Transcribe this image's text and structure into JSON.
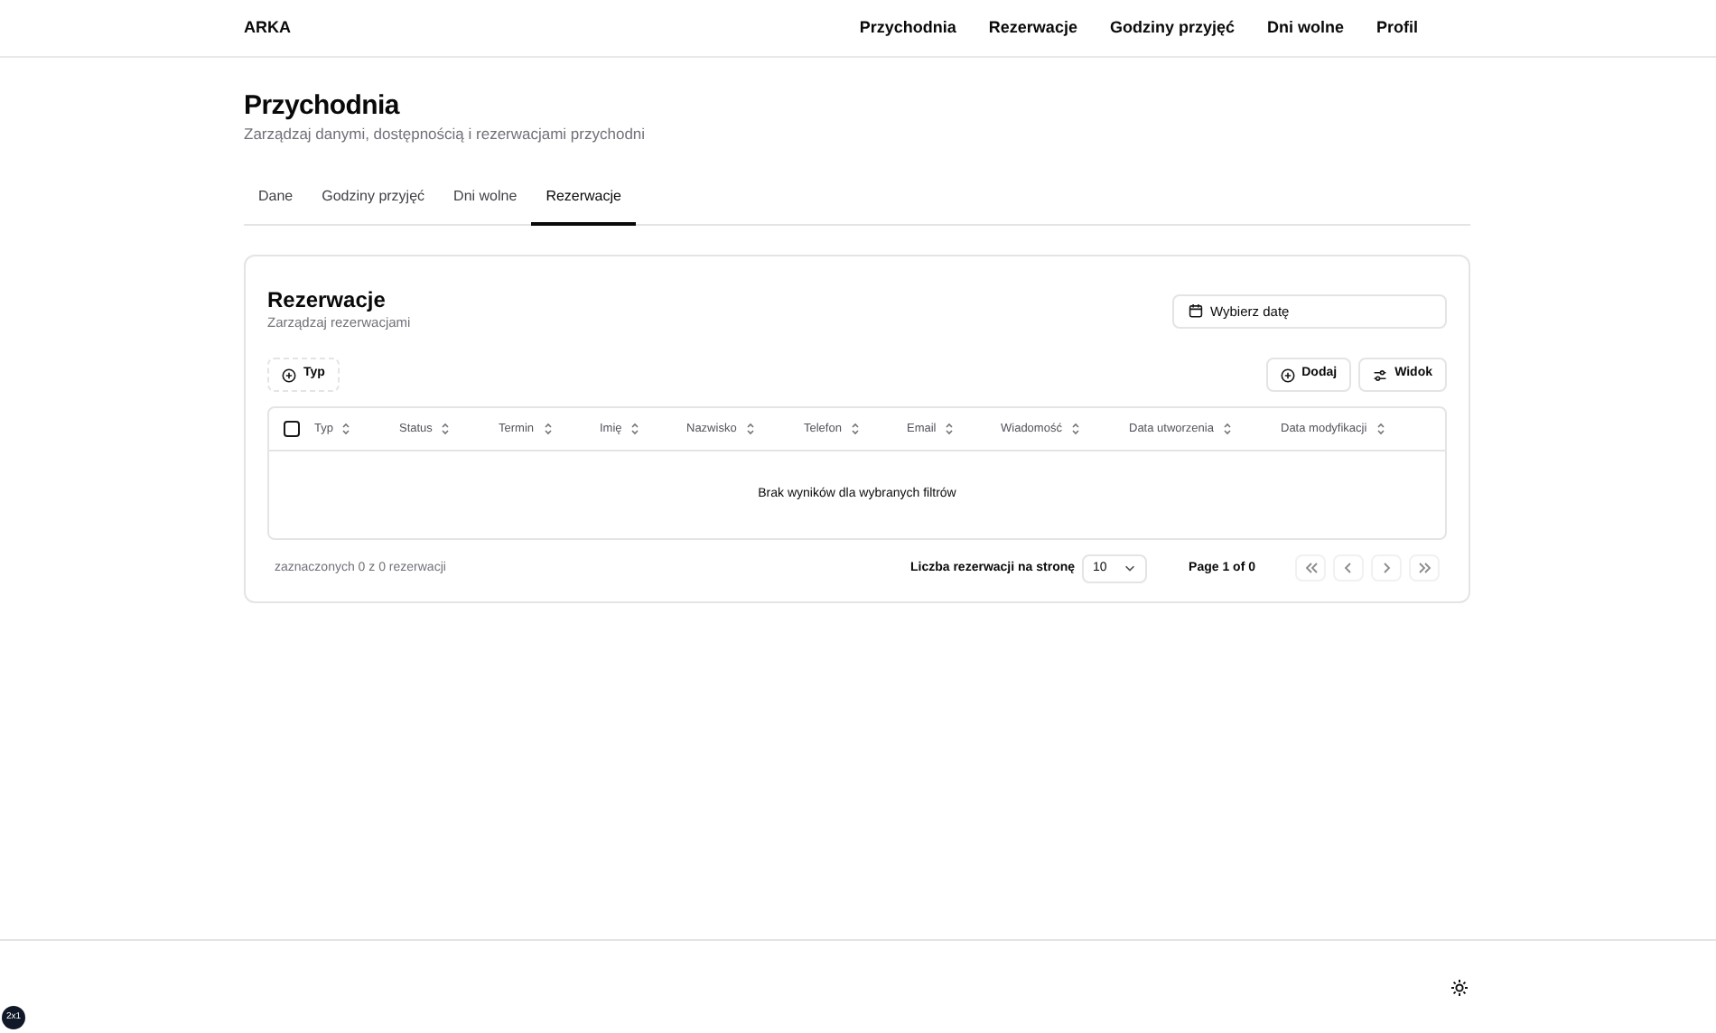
{
  "brand": "ARKA",
  "nav": [
    "Przychodnia",
    "Rezerwacje",
    "Godziny przyjęć",
    "Dni wolne",
    "Profil"
  ],
  "page": {
    "title": "Przychodnia",
    "subtitle": "Zarządzaj danymi, dostępnością i rezerwacjami przychodni"
  },
  "tabs": [
    {
      "label": "Dane",
      "selected": false
    },
    {
      "label": "Godziny przyjęć",
      "selected": false
    },
    {
      "label": "Dni wolne",
      "selected": false
    },
    {
      "label": "Rezerwacje",
      "selected": true
    }
  ],
  "card": {
    "title": "Rezerwacje",
    "subtitle": "Zarządzaj rezerwacjami",
    "date_picker": {
      "placeholder": "Wybierz datę"
    },
    "filter": "Typ",
    "actions": [
      "Dodaj",
      "Widok"
    ],
    "select_all": {
      "checked": false
    },
    "columns": [
      "Typ",
      "Status",
      "Termin",
      "Imię",
      "Nazwisko",
      "Telefon",
      "Email",
      "Wiadomość",
      "Data utworzenia",
      "Data modyfikacji"
    ],
    "empty": "Brak wyników dla wybranych filtrów",
    "selected_count": "zaznaczonych 0 z 0 rezerwacji",
    "page_size_label": "Liczba rezerwacji na stronę",
    "page_size": "10",
    "page_info": "Page 1 of 0",
    "pager": [
      {
        "kind": "first",
        "disabled": true
      },
      {
        "kind": "prev",
        "disabled": true
      },
      {
        "kind": "next",
        "disabled": true
      },
      {
        "kind": "last",
        "disabled": true
      }
    ]
  },
  "dev_badge": "2x1"
}
